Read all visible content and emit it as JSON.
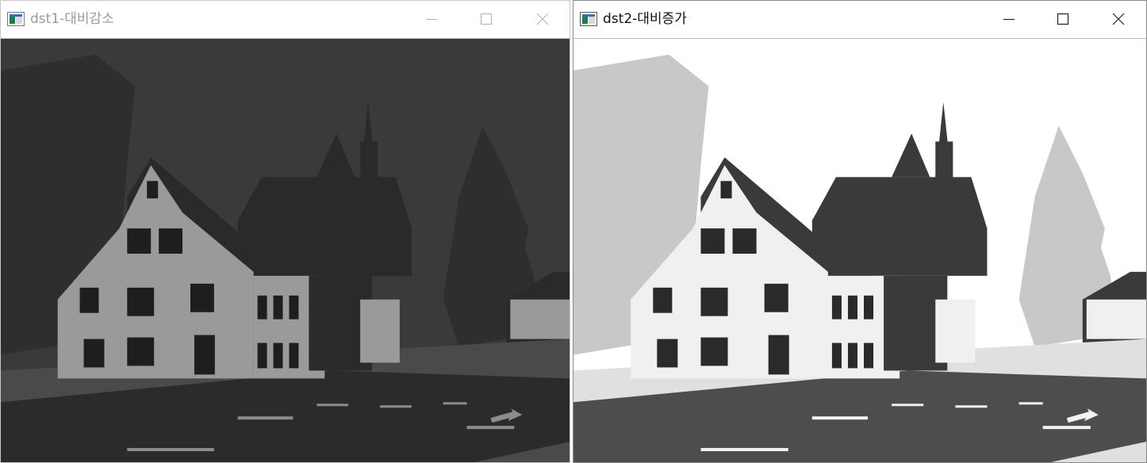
{
  "windows": [
    {
      "title": "dst1-대비감소",
      "active": false,
      "image_icon": "photo-icon",
      "image_tone": "reduced-contrast"
    },
    {
      "title": "dst2-대비증가",
      "active": true,
      "image_icon": "photo-icon",
      "image_tone": "increased-contrast"
    }
  ],
  "controls": {
    "minimize": "minimize-icon",
    "maximize": "maximize-icon",
    "close": "close-icon"
  },
  "colors": {
    "dst1": {
      "sky": "#3a3a3a",
      "house": "#9a9a9a",
      "roof": "#2a2a2a",
      "trees": "#2e2e2e",
      "road": "#2b2b2b",
      "ground": "#4a4a4a",
      "window": "#1e1e1e",
      "marking": "#8c8c8c"
    },
    "dst2": {
      "sky": "#ffffff",
      "house": "#f0f0f0",
      "roof": "#3a3a3a",
      "trees": "#c8c8c8",
      "road": "#4d4d4d",
      "ground": "#e0e0e0",
      "window": "#2a2a2a",
      "marking": "#f2f2f2"
    }
  }
}
